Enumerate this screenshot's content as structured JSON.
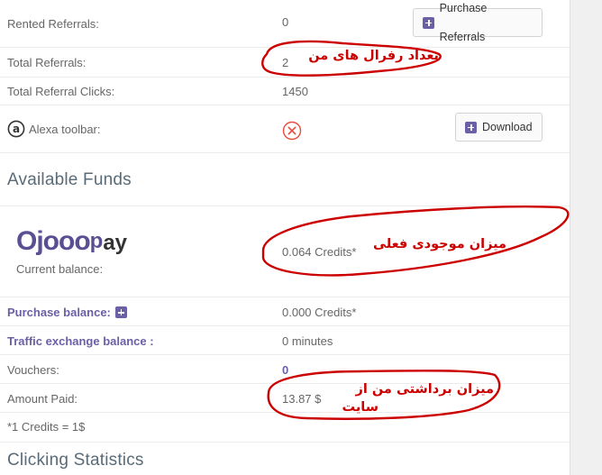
{
  "referrals": {
    "rented_label": "Rented Referrals:",
    "rented_value": "0",
    "purchase_referrals_label": "Purchase Referrals",
    "total_label": "Total Referrals:",
    "total_value": "2",
    "clicks_label": "Total Referral Clicks:",
    "clicks_value": "1450",
    "alexa_label": "Alexa toolbar:",
    "download_label": "Download"
  },
  "funds": {
    "heading": "Available Funds",
    "logo_text_a": "Ojooo",
    "logo_text_b": "ay",
    "current_balance_label": "Current balance:",
    "current_balance_value": "0.064 Credits*",
    "purchase_balance_label": "Purchase balance:",
    "purchase_balance_value": "0.000 Credits*",
    "traffic_label": "Traffic exchange balance :",
    "traffic_value": "0 minutes",
    "vouchers_label": "Vouchers:",
    "vouchers_value": "0",
    "amount_paid_label": "Amount Paid:",
    "amount_paid_value": "13.87 $",
    "credits_note": "*1 Credits = 1$"
  },
  "clicking": {
    "heading": "Clicking Statistics"
  },
  "annotations": {
    "total_referrals_note": "تعداد رفرال های من",
    "current_balance_note": "میزان موجودی فعلی",
    "amount_paid_note_line1": "میزان برداشتی من از",
    "amount_paid_note_line2": "سایت"
  },
  "colors": {
    "accent": "#6b5fa6",
    "annotation": "#cc0000",
    "status_error": "#e74c3c"
  }
}
